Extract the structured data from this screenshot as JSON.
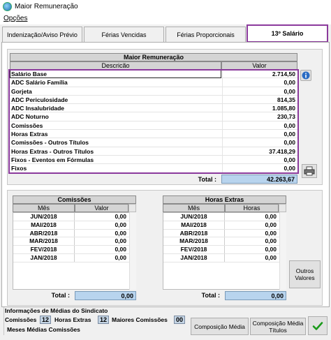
{
  "window": {
    "title": "Maior Remuneração"
  },
  "menu": {
    "opcoes": "Opções"
  },
  "tabs": [
    {
      "label": "Indenização/Aviso Prévio"
    },
    {
      "label": "Férias Vencidas"
    },
    {
      "label": "Férias Proporcionais"
    },
    {
      "label": "13º Salário"
    }
  ],
  "main_grid": {
    "title": "Maior Remuneração",
    "col_descricao": "Descricão",
    "col_valor": "Valor",
    "rows": [
      {
        "desc": "Salário Base",
        "valor": "2.714,50"
      },
      {
        "desc": "ADC Salário Família",
        "valor": "0,00"
      },
      {
        "desc": "Gorjeta",
        "valor": "0,00"
      },
      {
        "desc": "ADC Periculosidade",
        "valor": "814,35"
      },
      {
        "desc": "ADC Insalubridade",
        "valor": "1.085,80"
      },
      {
        "desc": "ADC Noturno",
        "valor": "230,73"
      },
      {
        "desc": "Comissões",
        "valor": "0,00"
      },
      {
        "desc": "Horas Extras",
        "valor": "0,00"
      },
      {
        "desc": "Comissões - Outros Títulos",
        "valor": "0,00"
      },
      {
        "desc": "Horas Extras - Outros Títulos",
        "valor": "37.418,29"
      },
      {
        "desc": "Fixos - Eventos em Fórmulas",
        "valor": "0,00"
      },
      {
        "desc": "Fixos",
        "valor": "0,00"
      }
    ],
    "total_label": "Total :",
    "total_value": "42.263,67"
  },
  "comissoes": {
    "title": "Comissões",
    "col_mes": "Mês",
    "col_valor": "Valor",
    "rows": [
      {
        "mes": "JUN/2018",
        "valor": "0,00"
      },
      {
        "mes": "MAI/2018",
        "valor": "0,00"
      },
      {
        "mes": "ABR/2018",
        "valor": "0,00"
      },
      {
        "mes": "MAR/2018",
        "valor": "0,00"
      },
      {
        "mes": "FEV/2018",
        "valor": "0,00"
      },
      {
        "mes": "JAN/2018",
        "valor": "0,00"
      }
    ],
    "total_label": "Total :",
    "total_value": "0,00"
  },
  "horas_extras": {
    "title": "Horas Extras",
    "col_mes": "Mês",
    "col_horas": "Horas",
    "rows": [
      {
        "mes": "JUN/2018",
        "valor": "0,00"
      },
      {
        "mes": "MAI/2018",
        "valor": "0,00"
      },
      {
        "mes": "ABR/2018",
        "valor": "0,00"
      },
      {
        "mes": "MAR/2018",
        "valor": "0,00"
      },
      {
        "mes": "FEV/2018",
        "valor": "0,00"
      },
      {
        "mes": "JAN/2018",
        "valor": "0,00"
      }
    ],
    "total_label": "Total :",
    "total_value": "0,00"
  },
  "outros_valores_button": "Outros Valores",
  "sindicato": {
    "title": "Informações de Médias do Sindicato",
    "comissoes_label": "Comissões",
    "comissoes_value": "12",
    "horas_extras_label": "Horas Extras",
    "horas_extras_value": "12",
    "maiores_comissoes_label": "Maiores Comissões",
    "maiores_comissoes_value": "00",
    "meses_medias_label": "Meses Médias Comissões"
  },
  "buttons": {
    "composicao_media": "Composição Média",
    "composicao_media_titulos": "Composição Média Títulos"
  },
  "colors": {
    "highlight_border": "#8b3a9c",
    "total_bg": "#b8d4ee",
    "confirm_check": "#1a9a1a"
  },
  "icons": [
    "app-icon",
    "info-icon",
    "printer-icon",
    "checkmark-icon",
    "scroll-arrow-icon"
  ]
}
